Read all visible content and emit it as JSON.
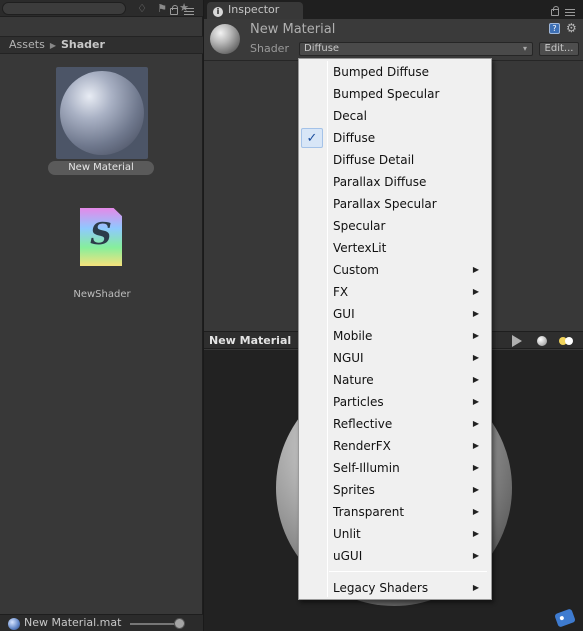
{
  "project": {
    "breadcrumb": {
      "root": "Assets",
      "current": "Shader"
    },
    "assets": [
      {
        "name": "New Material",
        "type": "material",
        "selected": true
      },
      {
        "name": "NewShader",
        "type": "shader",
        "glyph": "S"
      }
    ],
    "footer": {
      "selected_file": "New Material.mat"
    }
  },
  "inspector": {
    "tab_label": "Inspector",
    "material_name": "New Material",
    "shader_label": "Shader",
    "shader_value": "Diffuse",
    "edit_label": "Edit..."
  },
  "preview": {
    "title": "New Material"
  },
  "shader_menu": {
    "checked_item": "Diffuse",
    "items": [
      {
        "label": "Bumped Diffuse",
        "submenu": false
      },
      {
        "label": "Bumped Specular",
        "submenu": false
      },
      {
        "label": "Decal",
        "submenu": false
      },
      {
        "label": "Diffuse",
        "submenu": false,
        "checked": true
      },
      {
        "label": "Diffuse Detail",
        "submenu": false
      },
      {
        "label": "Parallax Diffuse",
        "submenu": false
      },
      {
        "label": "Parallax Specular",
        "submenu": false
      },
      {
        "label": "Specular",
        "submenu": false
      },
      {
        "label": "VertexLit",
        "submenu": false
      },
      {
        "label": "Custom",
        "submenu": true
      },
      {
        "label": "FX",
        "submenu": true
      },
      {
        "label": "GUI",
        "submenu": true
      },
      {
        "label": "Mobile",
        "submenu": true
      },
      {
        "label": "NGUI",
        "submenu": true
      },
      {
        "label": "Nature",
        "submenu": true
      },
      {
        "label": "Particles",
        "submenu": true
      },
      {
        "label": "Reflective",
        "submenu": true
      },
      {
        "label": "RenderFX",
        "submenu": true
      },
      {
        "label": "Self-Illumin",
        "submenu": true
      },
      {
        "label": "Sprites",
        "submenu": true
      },
      {
        "label": "Transparent",
        "submenu": true
      },
      {
        "label": "Unlit",
        "submenu": true
      },
      {
        "label": "uGUI",
        "submenu": true
      }
    ],
    "footer_item": {
      "label": "Legacy Shaders",
      "submenu": true
    }
  },
  "colors": {
    "panel_bg": "#383838",
    "menu_bg": "#f0f0f0",
    "check_accent": "#1d4f9e"
  }
}
